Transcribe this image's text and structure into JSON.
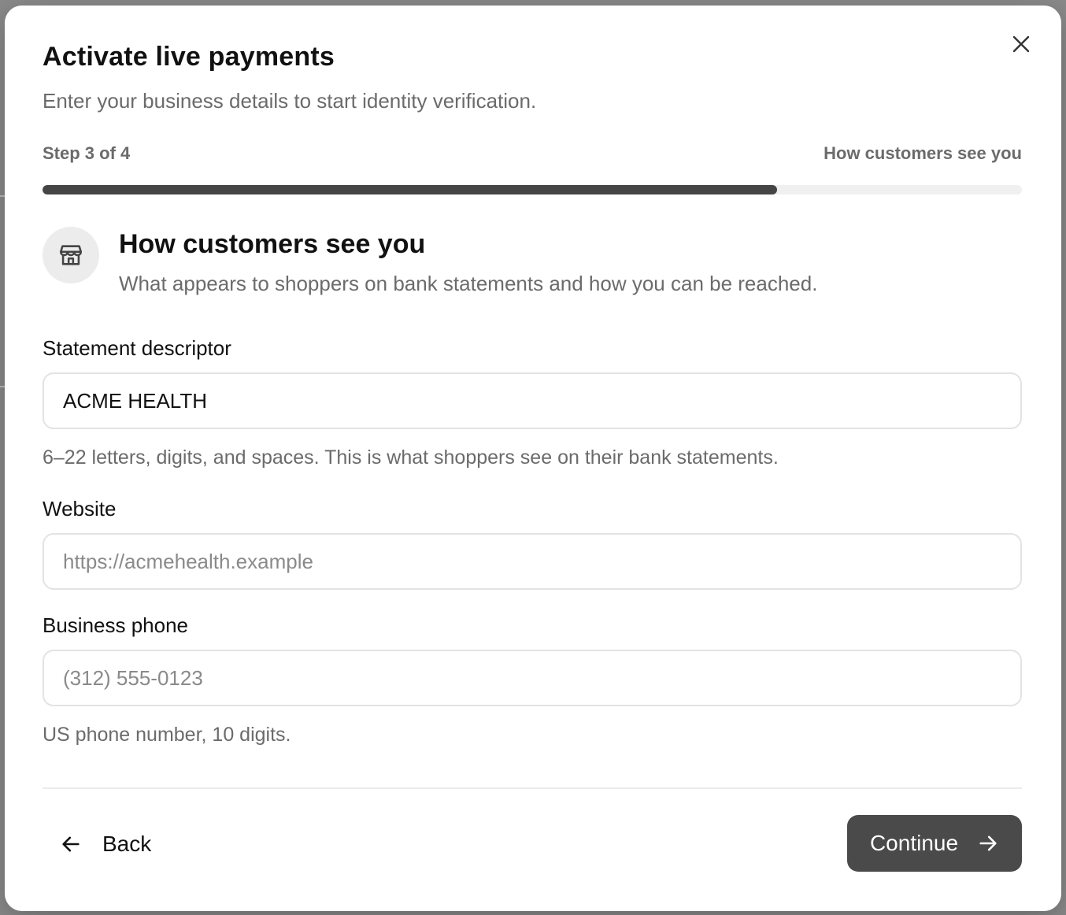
{
  "modal": {
    "title": "Activate live payments",
    "subtitle": "Enter your business details to start identity verification."
  },
  "progress": {
    "step_label": "Step 3 of 4",
    "step_name": "How customers see you",
    "fraction": 0.75
  },
  "section": {
    "icon": "storefront-icon",
    "title": "How customers see you",
    "subtitle": "What appears to shoppers on bank statements and how you can be reached."
  },
  "fields": {
    "statement_descriptor": {
      "label": "Statement descriptor",
      "value": "ACME HEALTH",
      "helper": "6–22 letters, digits, and spaces. This is what shoppers see on their bank statements."
    },
    "website": {
      "label": "Website",
      "value": "",
      "placeholder": "https://acmehealth.example"
    },
    "business_phone": {
      "label": "Business phone",
      "value": "",
      "placeholder": "(312) 555-0123",
      "helper": "US phone number, 10 digits."
    }
  },
  "footer": {
    "back_label": "Back",
    "continue_label": "Continue"
  },
  "colors": {
    "primary_button": "#4a4a4a",
    "progress_fill": "#454545",
    "progress_track": "#f0f0f0"
  }
}
